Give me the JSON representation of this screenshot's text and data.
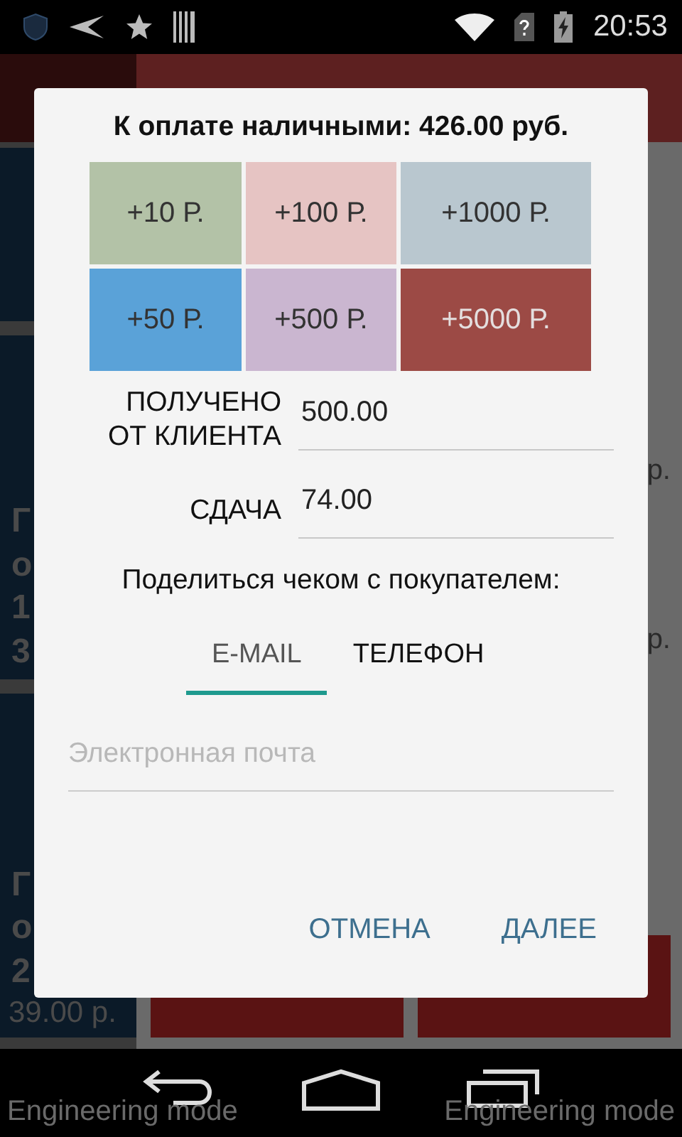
{
  "status_bar": {
    "time": "20:53"
  },
  "background": {
    "cards": [
      {
        "lines": [
          "Г",
          "о",
          "1",
          "3"
        ]
      },
      {
        "lines": [
          "Г",
          "о",
          "2",
          "39.00 р."
        ]
      }
    ],
    "prices": [
      "р.",
      "р."
    ]
  },
  "dialog": {
    "title": "К оплате наличными: 426.00 руб.",
    "quick_amounts": [
      {
        "label": "+10 Р.",
        "color": "#b3c2a7"
      },
      {
        "label": "+100 Р.",
        "color": "#e6c4c3"
      },
      {
        "label": "+1000 Р.",
        "color": "#b9c7cf"
      },
      {
        "label": "+50 Р.",
        "color": "#5aa2d8"
      },
      {
        "label": "+500 Р.",
        "color": "#cab6d0"
      },
      {
        "label": "+5000 Р.",
        "color": "#9c4a45"
      }
    ],
    "fields": [
      {
        "label": "ПОЛУЧЕНО ОТ КЛИЕНТА",
        "value": "500.00"
      },
      {
        "label": "СДАЧА",
        "value": "74.00"
      }
    ],
    "share_label": "Поделиться чеком с покупателем:",
    "tabs": [
      {
        "label": "E-MAIL",
        "selected": true
      },
      {
        "label": "ТЕЛЕФОН",
        "selected": false
      }
    ],
    "email": {
      "placeholder": "Электронная почта"
    },
    "buttons": [
      "ОТМЕНА",
      "ДАЛЕЕ"
    ]
  },
  "overlay_texts": [
    "Engineering mode",
    "Engineering mode"
  ]
}
